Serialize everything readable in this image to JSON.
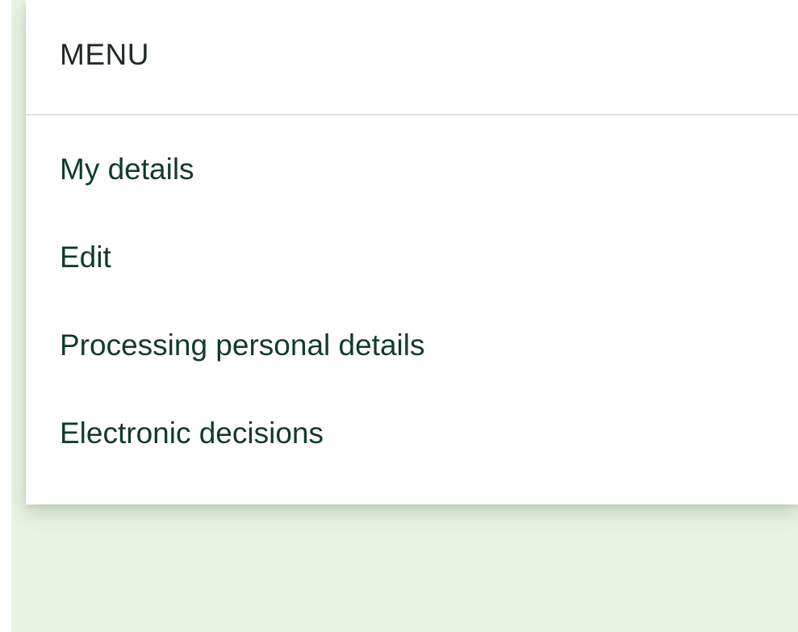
{
  "menu": {
    "title": "MENU",
    "items": [
      {
        "label": "My details"
      },
      {
        "label": "Edit"
      },
      {
        "label": "Processing personal details"
      },
      {
        "label": "Electronic decisions"
      }
    ]
  }
}
